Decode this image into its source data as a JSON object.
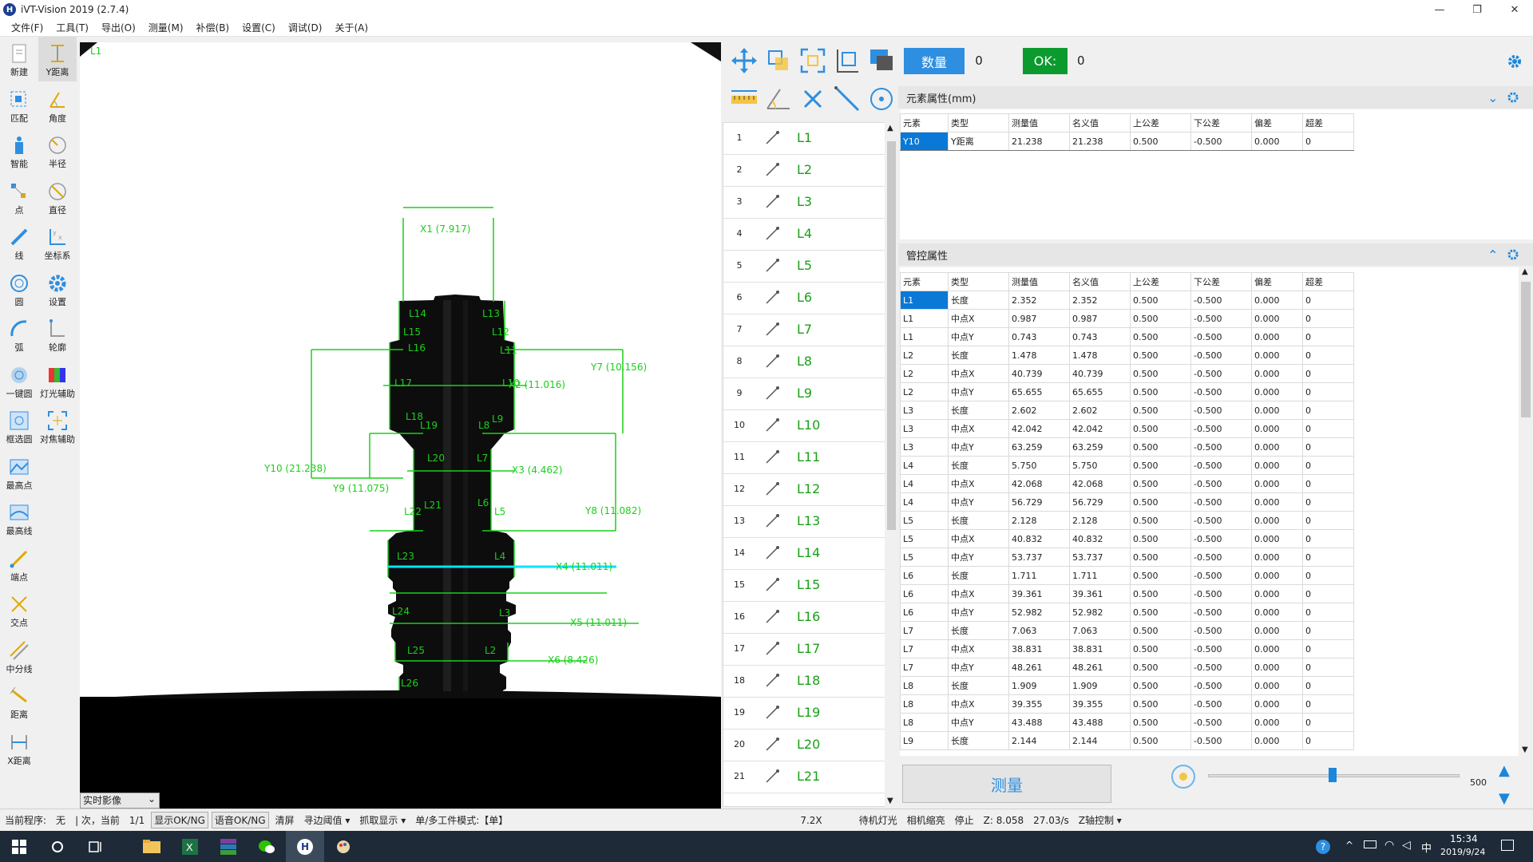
{
  "window": {
    "title": "iVT-Vision 2019  (2.7.4)",
    "logo_letter": "H",
    "minimize": "—",
    "maximize": "❐",
    "close": "✕"
  },
  "menu": [
    "文件(F)",
    "工具(T)",
    "导出(O)",
    "测量(M)",
    "补偿(B)",
    "设置(C)",
    "调试(D)",
    "关于(A)"
  ],
  "toolbar_left": [
    {
      "label": "新建",
      "icon": "new-file-icon"
    },
    {
      "label": "Y距离",
      "icon": "y-distance-icon"
    },
    {
      "label": "匹配",
      "icon": "match-icon"
    },
    {
      "label": "角度",
      "icon": "angle-icon"
    },
    {
      "label": "智能",
      "icon": "smart-icon"
    },
    {
      "label": "半径",
      "icon": "radius-icon"
    },
    {
      "label": "点",
      "icon": "point-icon"
    },
    {
      "label": "直径",
      "icon": "diameter-icon"
    },
    {
      "label": "线",
      "icon": "line-icon"
    },
    {
      "label": "坐标系",
      "icon": "coordinate-icon"
    },
    {
      "label": "圆",
      "icon": "circle-icon"
    },
    {
      "label": "设置",
      "icon": "gear-icon"
    },
    {
      "label": "弧",
      "icon": "arc-icon"
    },
    {
      "label": "轮廓",
      "icon": "contour-icon"
    },
    {
      "label": "一键圆",
      "icon": "one-click-circle-icon"
    },
    {
      "label": "灯光辅助",
      "icon": "light-assist-icon"
    },
    {
      "label": "框选圆",
      "icon": "box-select-icon"
    },
    {
      "label": "对焦辅助",
      "icon": "focus-assist-icon"
    },
    {
      "label": "最高点",
      "icon": "highest-point-icon"
    },
    {
      "label": "最高线",
      "icon": "highest-line-icon"
    },
    {
      "label": "端点",
      "icon": "endpoint-icon"
    },
    {
      "label": "交点",
      "icon": "intersection-icon"
    },
    {
      "label": "中分线",
      "icon": "midline-icon"
    },
    {
      "label": "距离",
      "icon": "distance-icon"
    },
    {
      "label": "X距离",
      "icon": "x-distance-icon"
    }
  ],
  "canvas": {
    "corner_label": "L1",
    "view_label": "实时影像",
    "line_labels": [
      "L14",
      "L13",
      "L15",
      "L12",
      "L16",
      "L11",
      "L17",
      "L10",
      "L18",
      "L9",
      "L19",
      "L8",
      "L20",
      "L7",
      "L21",
      "L6",
      "L22",
      "L5",
      "L23",
      "L4",
      "L24",
      "L3",
      "L25",
      "L2",
      "L26"
    ],
    "dims": {
      "x1": "X1  (7.917)",
      "x2": "X2  (11.016)",
      "x3": "X3  (4.462)",
      "x4": "X4  (11.011)",
      "x5": "X5  (11.011)",
      "x6": "X6  (8.426)",
      "y7": "Y7  (10.156)",
      "y8": "Y8  (11.082)",
      "y9": "Y9  (11.075)",
      "y10": "Y10  (21.238)"
    }
  },
  "element_list": [
    "L1",
    "L2",
    "L3",
    "L4",
    "L5",
    "L6",
    "L7",
    "L8",
    "L9",
    "L10",
    "L11",
    "L12",
    "L13",
    "L14",
    "L15",
    "L16",
    "L17",
    "L18",
    "L19",
    "L20",
    "L21"
  ],
  "counters": {
    "count_label": "数量",
    "count_value": "0",
    "ok_label": "OK:",
    "ok_value": "0"
  },
  "element_props": {
    "title": "元素属性(mm)",
    "headers": [
      "元素",
      "类型",
      "测量值",
      "名义值",
      "上公差",
      "下公差",
      "偏差",
      "超差"
    ],
    "rows": [
      [
        "Y10",
        "Y距离",
        "21.238",
        "21.238",
        "0.500",
        "-0.500",
        "0.000",
        "0"
      ]
    ]
  },
  "control_props": {
    "title": "管控属性",
    "headers": [
      "元素",
      "类型",
      "测量值",
      "名义值",
      "上公差",
      "下公差",
      "偏差",
      "超差"
    ],
    "rows": [
      [
        "L1",
        "长度",
        "2.352",
        "2.352",
        "0.500",
        "-0.500",
        "0.000",
        "0"
      ],
      [
        "L1",
        "中点X",
        "0.987",
        "0.987",
        "0.500",
        "-0.500",
        "0.000",
        "0"
      ],
      [
        "L1",
        "中点Y",
        "0.743",
        "0.743",
        "0.500",
        "-0.500",
        "0.000",
        "0"
      ],
      [
        "L2",
        "长度",
        "1.478",
        "1.478",
        "0.500",
        "-0.500",
        "0.000",
        "0"
      ],
      [
        "L2",
        "中点X",
        "40.739",
        "40.739",
        "0.500",
        "-0.500",
        "0.000",
        "0"
      ],
      [
        "L2",
        "中点Y",
        "65.655",
        "65.655",
        "0.500",
        "-0.500",
        "0.000",
        "0"
      ],
      [
        "L3",
        "长度",
        "2.602",
        "2.602",
        "0.500",
        "-0.500",
        "0.000",
        "0"
      ],
      [
        "L3",
        "中点X",
        "42.042",
        "42.042",
        "0.500",
        "-0.500",
        "0.000",
        "0"
      ],
      [
        "L3",
        "中点Y",
        "63.259",
        "63.259",
        "0.500",
        "-0.500",
        "0.000",
        "0"
      ],
      [
        "L4",
        "长度",
        "5.750",
        "5.750",
        "0.500",
        "-0.500",
        "0.000",
        "0"
      ],
      [
        "L4",
        "中点X",
        "42.068",
        "42.068",
        "0.500",
        "-0.500",
        "0.000",
        "0"
      ],
      [
        "L4",
        "中点Y",
        "56.729",
        "56.729",
        "0.500",
        "-0.500",
        "0.000",
        "0"
      ],
      [
        "L5",
        "长度",
        "2.128",
        "2.128",
        "0.500",
        "-0.500",
        "0.000",
        "0"
      ],
      [
        "L5",
        "中点X",
        "40.832",
        "40.832",
        "0.500",
        "-0.500",
        "0.000",
        "0"
      ],
      [
        "L5",
        "中点Y",
        "53.737",
        "53.737",
        "0.500",
        "-0.500",
        "0.000",
        "0"
      ],
      [
        "L6",
        "长度",
        "1.711",
        "1.711",
        "0.500",
        "-0.500",
        "0.000",
        "0"
      ],
      [
        "L6",
        "中点X",
        "39.361",
        "39.361",
        "0.500",
        "-0.500",
        "0.000",
        "0"
      ],
      [
        "L6",
        "中点Y",
        "52.982",
        "52.982",
        "0.500",
        "-0.500",
        "0.000",
        "0"
      ],
      [
        "L7",
        "长度",
        "7.063",
        "7.063",
        "0.500",
        "-0.500",
        "0.000",
        "0"
      ],
      [
        "L7",
        "中点X",
        "38.831",
        "38.831",
        "0.500",
        "-0.500",
        "0.000",
        "0"
      ],
      [
        "L7",
        "中点Y",
        "48.261",
        "48.261",
        "0.500",
        "-0.500",
        "0.000",
        "0"
      ],
      [
        "L8",
        "长度",
        "1.909",
        "1.909",
        "0.500",
        "-0.500",
        "0.000",
        "0"
      ],
      [
        "L8",
        "中点X",
        "39.355",
        "39.355",
        "0.500",
        "-0.500",
        "0.000",
        "0"
      ],
      [
        "L8",
        "中点Y",
        "43.488",
        "43.488",
        "0.500",
        "-0.500",
        "0.000",
        "0"
      ],
      [
        "L9",
        "长度",
        "2.144",
        "2.144",
        "0.500",
        "-0.500",
        "0.000",
        "0"
      ]
    ]
  },
  "measure_button": "测量",
  "slider": {
    "value": "500"
  },
  "status": {
    "program_label": "当前程序:",
    "program_value": "无",
    "count_text": "| 次，当前",
    "page": "1/1",
    "btn_show": "显示OK/NG",
    "btn_voice": "语音OK/NG",
    "btn_clear": "清屏",
    "edge": "寻边阈值 ▾",
    "grab": "抓取显示 ▾",
    "mode": "单/多工件模式:【单】",
    "zoom": "7.2X",
    "light": "待机灯光",
    "camera": "相机缩亮",
    "stop": "停止",
    "z": "Z:  8.058",
    "rate": "27.03/s",
    "z_ctrl": "Z轴控制 ▾"
  },
  "taskbar": {
    "time": "15:34",
    "date": "2019/9/24",
    "ime": "中"
  },
  "colors": {
    "accent": "#0a78d7",
    "measure_green": "#19d019",
    "highlight_cyan": "#00e5ff",
    "ok_green": "#0b9a2e",
    "count_blue": "#2e8fe0"
  }
}
